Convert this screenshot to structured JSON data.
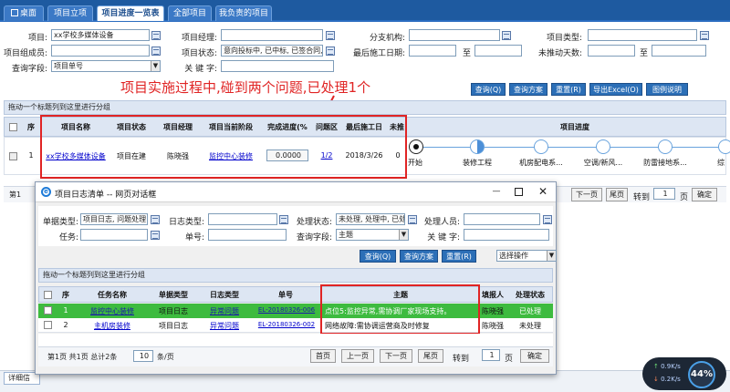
{
  "tabs": [
    {
      "label": "桌面"
    },
    {
      "label": "项目立项"
    },
    {
      "label": "项目进度一览表"
    },
    {
      "label": "全部项目"
    },
    {
      "label": "我负责的项目"
    }
  ],
  "filters": {
    "project_label": "项目:",
    "project_value": "xx学校多媒体设备",
    "manager_label": "项目经理:",
    "branch_label": "分支机构:",
    "type_label": "项目类型:",
    "members_label": "项目组成员:",
    "status_label": "项目状态:",
    "status_value": "意向投标中, 已中标, 已签合同, 项",
    "last_date_label": "最后施工日期:",
    "to1": "至",
    "days_label": "未推动天数:",
    "to2": "至",
    "query_field_label": "查询字段:",
    "query_field_value": "项目单号",
    "keyword_label": "关 键 字:"
  },
  "annotation": "项目实施过程中,碰到两个问题,已处理1个",
  "toolbar": {
    "query": "查询(Q)",
    "scheme": "查询方案",
    "reset": "重置(R)",
    "export": "导出Excel(O)",
    "legend": "图例说明"
  },
  "group_hint": "拖动一个标题列到这里进行分组",
  "main_table": {
    "headers": {
      "seq": "序",
      "name": "项目名称",
      "status": "项目状态",
      "manager": "项目经理",
      "stage": "项目当前阶段",
      "progress": "完成进度(%",
      "issue": "问题区",
      "last_date": "最后施工日",
      "unpushed": "未推",
      "schedule": "项目进度"
    },
    "row": {
      "seq": "1",
      "name": "xx学校多媒体设备",
      "status": "项目在建",
      "manager": "陈晓强",
      "stage": "监控中心装修",
      "progress": "0.0000",
      "issue": "1/2",
      "last_date": "2018/3/26",
      "unpushed": "0"
    },
    "stages": [
      {
        "label": "开始"
      },
      {
        "label": "装修工程"
      },
      {
        "label": "机房配电系..."
      },
      {
        "label": "空调/新风..."
      },
      {
        "label": "防雷接地系..."
      },
      {
        "label": "综"
      }
    ],
    "pager": {
      "first_prefix": "第",
      "first_page": "1",
      "prev": "上一页",
      "next": "下一页",
      "last": "尾页",
      "goto": "转到",
      "goto_value": "1",
      "page_unit": "页",
      "confirm": "确定"
    }
  },
  "dialog": {
    "title": "项目日志清单 -- 网页对话框",
    "log_type_label": "单据类型:",
    "log_type_value": "项目日志, 问题处理",
    "diary_type_label": "日志类型:",
    "handle_status_label": "处理状态:",
    "handle_status_value": "未处理, 处理中, 已处理",
    "handler_label": "处理人员:",
    "task_label": "任务:",
    "doc_no_label": "单号:",
    "query_field_label": "查询字段:",
    "query_field_value": "主题",
    "keyword_label": "关 键 字:",
    "query": "查询(Q)",
    "scheme": "查询方案",
    "reset": "重置(R)",
    "select_op": "选择操作",
    "group_hint": "拖动一个标题列到这里进行分组",
    "headers": {
      "seq": "序",
      "task": "任务名称",
      "doc_type": "单据类型",
      "log_type": "日志类型",
      "doc_no": "单号",
      "subject": "主题",
      "reporter": "填报人",
      "status": "处理状态"
    },
    "rows": [
      {
        "seq": "1",
        "task": "监控中心装修",
        "doc_type": "项目日志",
        "log_type": "异常问题",
        "doc_no": "EL-20180326-006",
        "subject": "点位5:监控异常,需协调厂家现场支持。",
        "reporter": "陈晓强",
        "status": "已处理"
      },
      {
        "seq": "2",
        "task": "主机房装修",
        "doc_type": "项目日志",
        "log_type": "异常问题",
        "doc_no": "EL-20180326-002",
        "subject": "网络故障:需协调运营商及时修复",
        "reporter": "陈晓强",
        "status": "未处理"
      }
    ],
    "pager": {
      "summary_a": "第1页 共1页 总计",
      "total": "2",
      "summary_b": "条",
      "per_page": "10",
      "per_unit": "条/页",
      "first": "首页",
      "prev": "上一页",
      "next": "下一页",
      "last": "尾页",
      "goto": "转到",
      "goto_value": "1",
      "page_unit": "页",
      "confirm": "确定"
    }
  },
  "bottom_tab": "详细信",
  "net_widget": {
    "up": "0.9K/s",
    "down": "0.2K/s",
    "percent": "44%"
  }
}
